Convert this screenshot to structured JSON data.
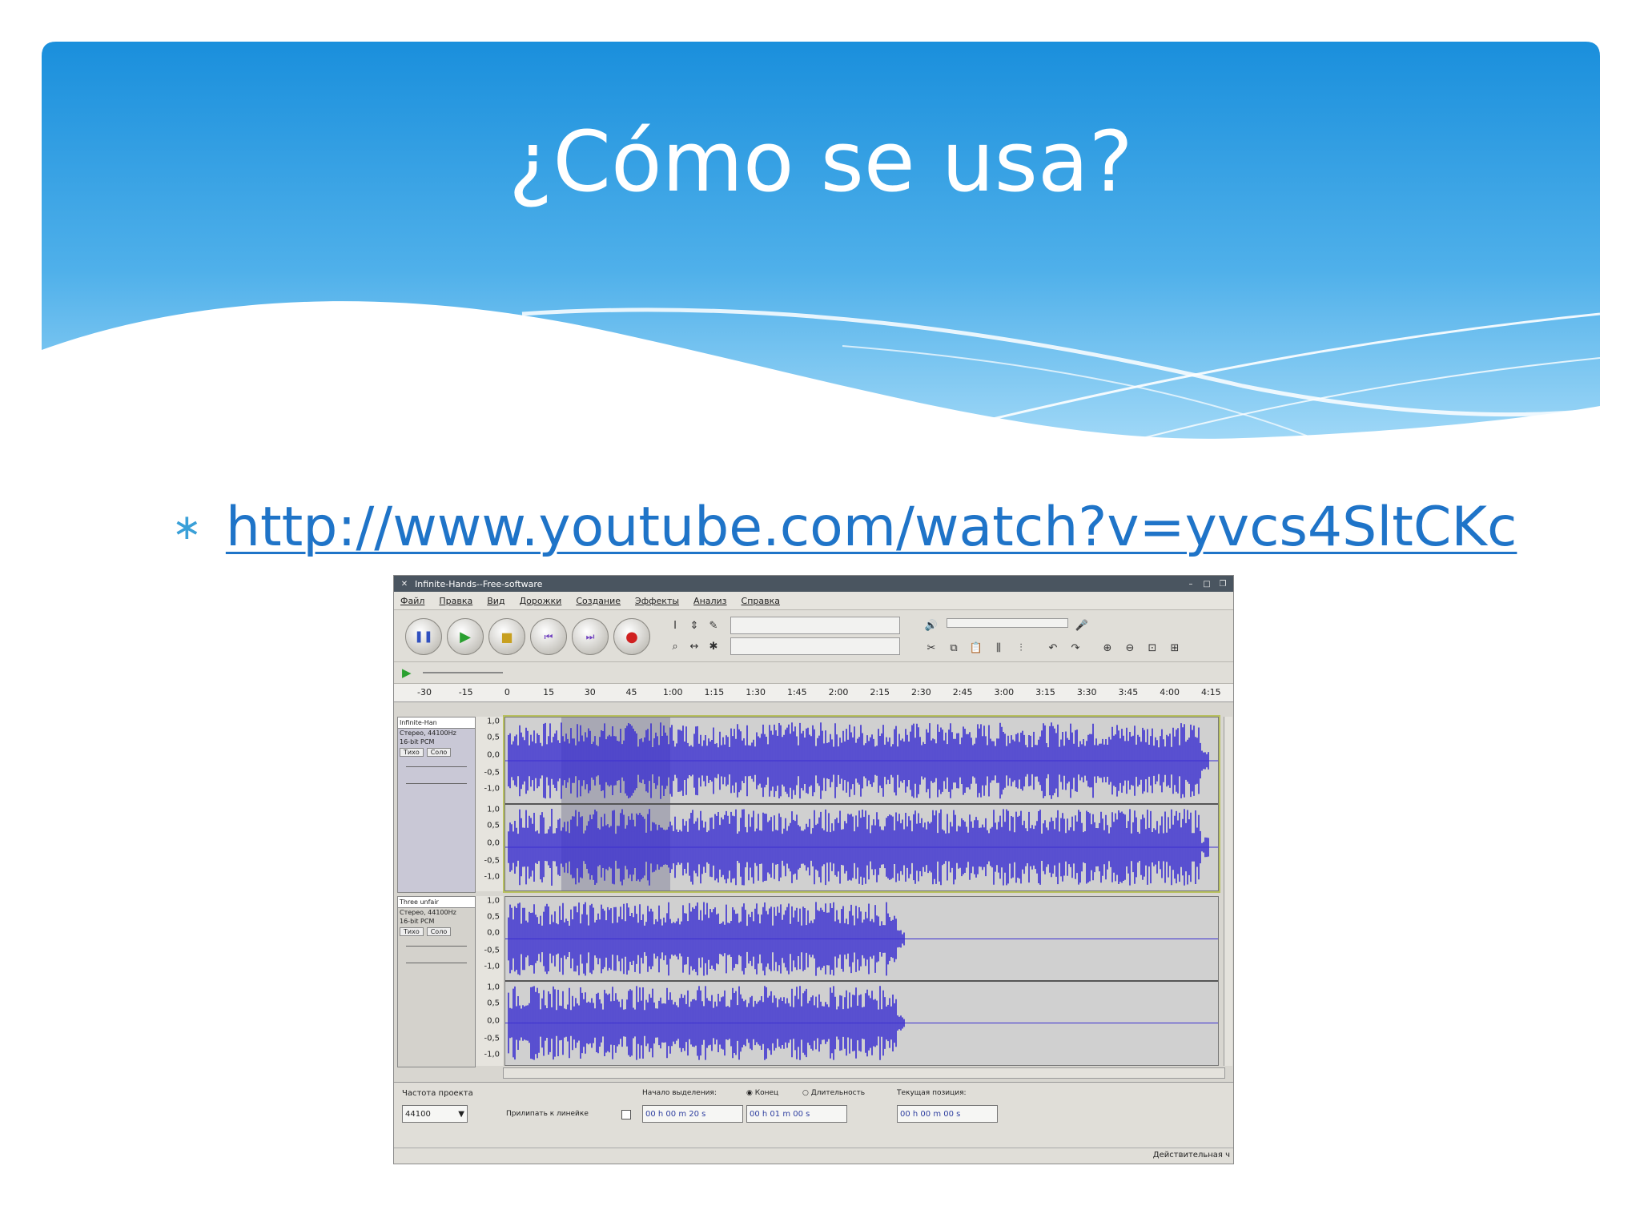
{
  "slide": {
    "title": "¿Cómo se usa?",
    "bullet": "∗",
    "link_text": "http://www.youtube.com/watch?v=yvcs4SltCKc"
  },
  "colors": {
    "banner_top": "#1a8fdc",
    "banner_bottom": "#9ed6f7",
    "link": "#1f74c8",
    "waveform": "#3b2fd0"
  },
  "app": {
    "window_title": "Infinite-Hands--Free-software",
    "menu": [
      "Файл",
      "Правка",
      "Вид",
      "Дорожки",
      "Создание",
      "Эффекты",
      "Анализ",
      "Справка"
    ],
    "ruler_labels": [
      "-30",
      "-15",
      "0",
      "15",
      "30",
      "45",
      "1:00",
      "1:15",
      "1:30",
      "1:45",
      "2:00",
      "2:15",
      "2:30",
      "2:45",
      "3:00",
      "3:15",
      "3:30",
      "3:45",
      "4:00",
      "4:15"
    ],
    "tracks": [
      {
        "name": "Infinite-Han",
        "info1": "Стерео, 44100Hz",
        "info2": "16-bit PCM",
        "mute": "Тихо",
        "solo": "Соло"
      },
      {
        "name": "Three unfair",
        "info1": "Стерео, 44100Hz",
        "info2": "16-bit PCM",
        "mute": "Тихо",
        "solo": "Соло"
      }
    ],
    "scale_labels": [
      "1,0",
      "0,5",
      "0,0",
      "-0,5",
      "-1,0"
    ],
    "bottom": {
      "rate_label": "Частота проекта",
      "rate_value": "44100",
      "snap_label": "Прилипать к линейке",
      "sel_start_label": "Начало выделения:",
      "end_label": "Конец",
      "length_label": "Длительность",
      "position_label": "Текущая позиция:",
      "sel_start_value": "00 h 00 m 20 s",
      "end_value": "00 h 01 m 00 s",
      "position_value": "00 h 00 m 00 s",
      "status": "Действительная ч"
    }
  }
}
